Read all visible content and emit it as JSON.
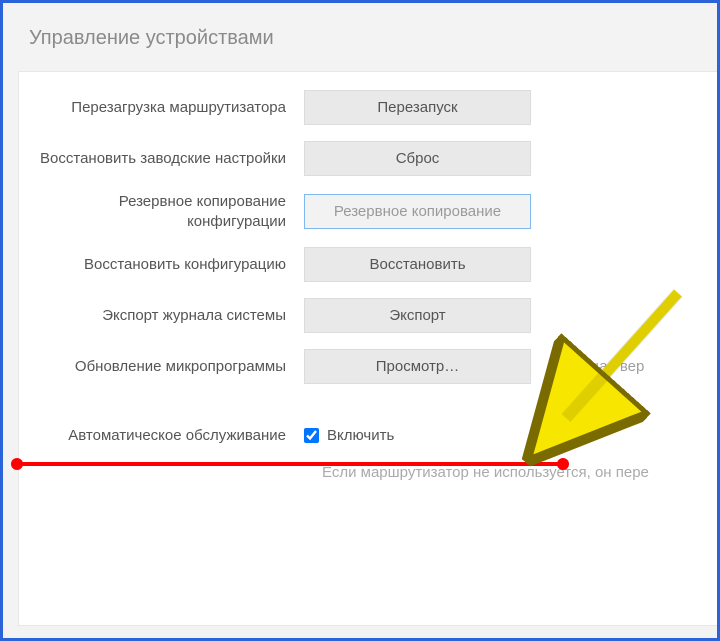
{
  "title": "Управление устройствами",
  "rows": {
    "reboot": {
      "label": "Перезагрузка маршрутизатора",
      "button": "Перезапуск"
    },
    "factory": {
      "label": "Восстановить заводские настройки",
      "button": "Сброс"
    },
    "backup": {
      "label": "Резервное копирование конфигурации",
      "button": "Резервное копирование"
    },
    "restore": {
      "label": "Восстановить конфигурацию",
      "button": "Восстановить"
    },
    "syslog": {
      "label": "Экспорт журнала системы",
      "button": "Экспорт"
    },
    "firmware": {
      "label": "Обновление микропрограммы",
      "button": "Просмотр…",
      "aside": "Текущая вер"
    },
    "automaint": {
      "label": "Автоматическое обслуживание",
      "checkbox_label": "Включить",
      "checked": true
    }
  },
  "note": "Если маршрутизатор не используется, он пере"
}
